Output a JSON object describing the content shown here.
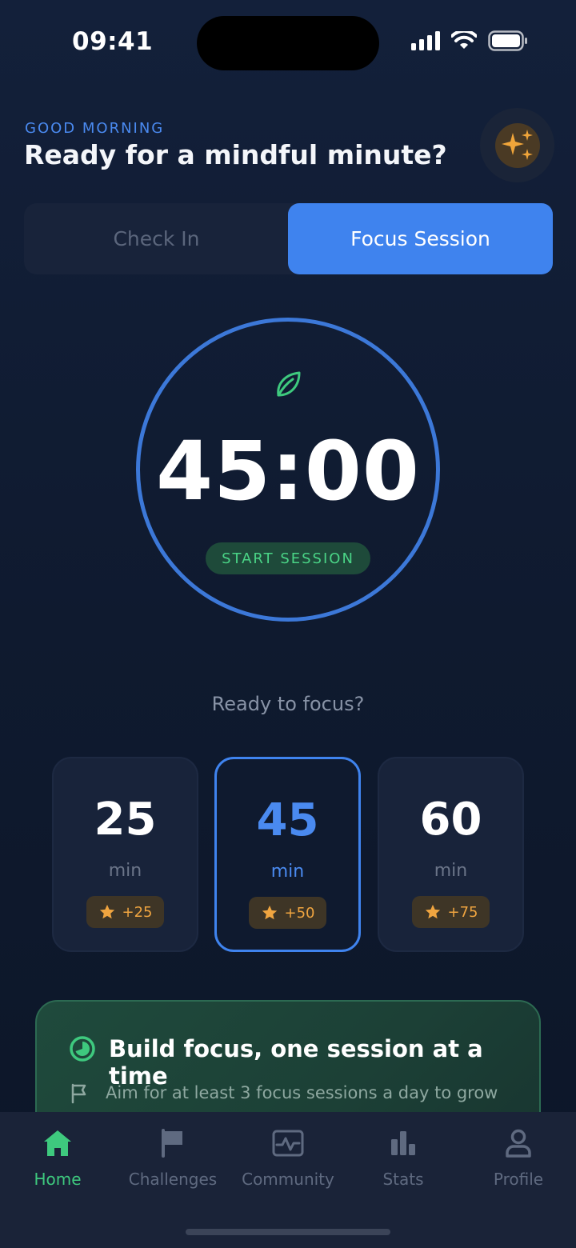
{
  "status_bar": {
    "time": "09:41",
    "icons": [
      "signal-icon",
      "wifi-icon",
      "battery-icon"
    ]
  },
  "header": {
    "greeting": "GOOD MORNING",
    "title": "Ready for a mindful minute?",
    "action_icon": "sparkles-icon"
  },
  "tabs": {
    "items": [
      "Check In",
      "Focus Session"
    ],
    "selected": "Focus Session"
  },
  "timer": {
    "icon": "leaf-icon",
    "display": "45:00",
    "start_label": "START SESSION"
  },
  "prompt": "Ready to focus?",
  "durations": [
    {
      "minutes": "25",
      "unit": "min",
      "reward": "+25",
      "selected": false
    },
    {
      "minutes": "45",
      "unit": "min",
      "reward": "+50",
      "selected": true
    },
    {
      "minutes": "60",
      "unit": "min",
      "reward": "+75",
      "selected": false
    }
  ],
  "tip": {
    "icon": "pie-timer-icon",
    "title": "Build focus, one session at a time",
    "flag_icon": "flag-icon",
    "body": "Aim for at least 3 focus sessions a day to grow"
  },
  "nav": {
    "items": [
      {
        "label": "Home",
        "icon": "home-icon",
        "active": true
      },
      {
        "label": "Challenges",
        "icon": "flag-icon",
        "active": false
      },
      {
        "label": "Community",
        "icon": "community-icon",
        "active": false
      },
      {
        "label": "Stats",
        "icon": "stats-icon",
        "active": false
      },
      {
        "label": "Profile",
        "icon": "profile-icon",
        "active": false
      }
    ]
  },
  "colors": {
    "accent": "#3f83ee",
    "green": "#3ec97e",
    "gold": "#f0a540",
    "background": "#111c30"
  }
}
